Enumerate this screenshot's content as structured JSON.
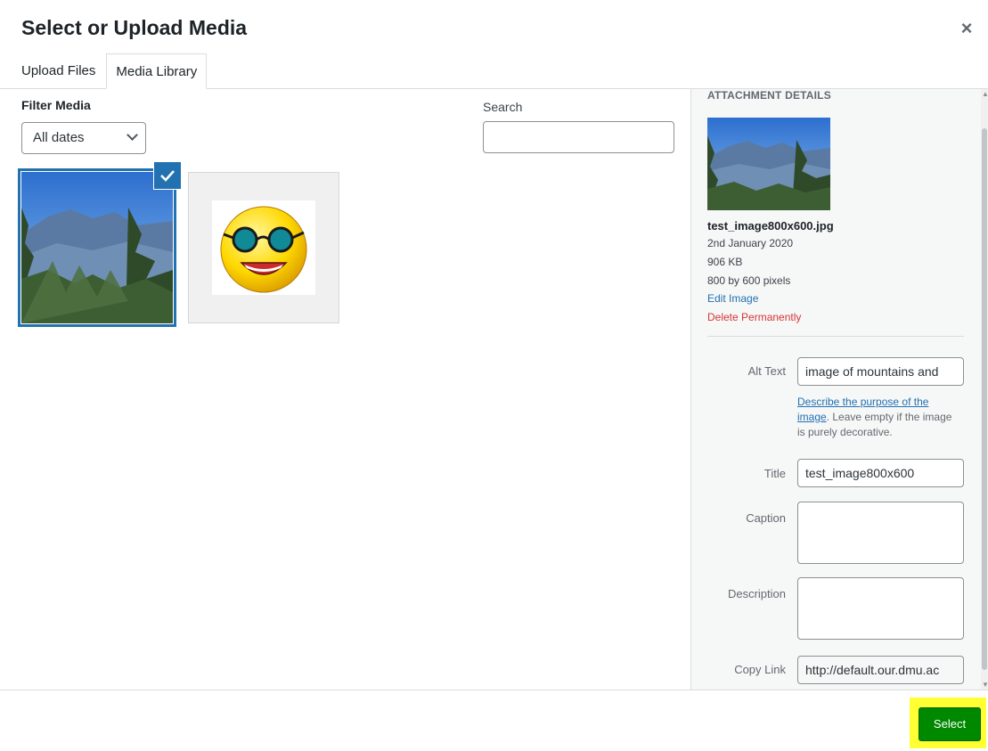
{
  "modal": {
    "title": "Select or Upload Media",
    "close_symbol": "×"
  },
  "tabs": [
    {
      "label": "Upload Files",
      "active": false
    },
    {
      "label": "Media Library",
      "active": true
    }
  ],
  "filter": {
    "label": "Filter Media",
    "date_value": "All dates"
  },
  "search": {
    "label": "Search",
    "value": ""
  },
  "media_items": [
    {
      "name": "mountain-forest-thumbnail",
      "selected": true
    },
    {
      "name": "sunglasses-smiley-thumbnail",
      "selected": false
    }
  ],
  "details": {
    "heading": "ATTACHMENT DETAILS",
    "filename": "test_image800x600.jpg",
    "date": "2nd January 2020",
    "size": "906 KB",
    "dimensions": "800 by 600 pixels",
    "edit_link": "Edit Image",
    "delete_link": "Delete Permanently",
    "alt_text": {
      "label": "Alt Text",
      "value": "image of mountains and"
    },
    "help": {
      "link_part1": "Describe the purpose of the",
      "link_part2": "image",
      "rest": ". Leave empty if the image is purely decorative."
    },
    "title": {
      "label": "Title",
      "value": "test_image800x600"
    },
    "caption": {
      "label": "Caption",
      "value": ""
    },
    "description": {
      "label": "Description",
      "value": ""
    },
    "copy_link": {
      "label": "Copy Link",
      "value": "http://default.our.dmu.ac"
    }
  },
  "footer": {
    "select_label": "Select"
  },
  "colors": {
    "accent": "#2271b1",
    "delete": "#d63638",
    "select_button": "#008800",
    "highlight": "#ffff33"
  },
  "icons": {
    "close": "close-icon",
    "dropdown": "chevron-down-icon",
    "check": "checkmark-icon"
  }
}
